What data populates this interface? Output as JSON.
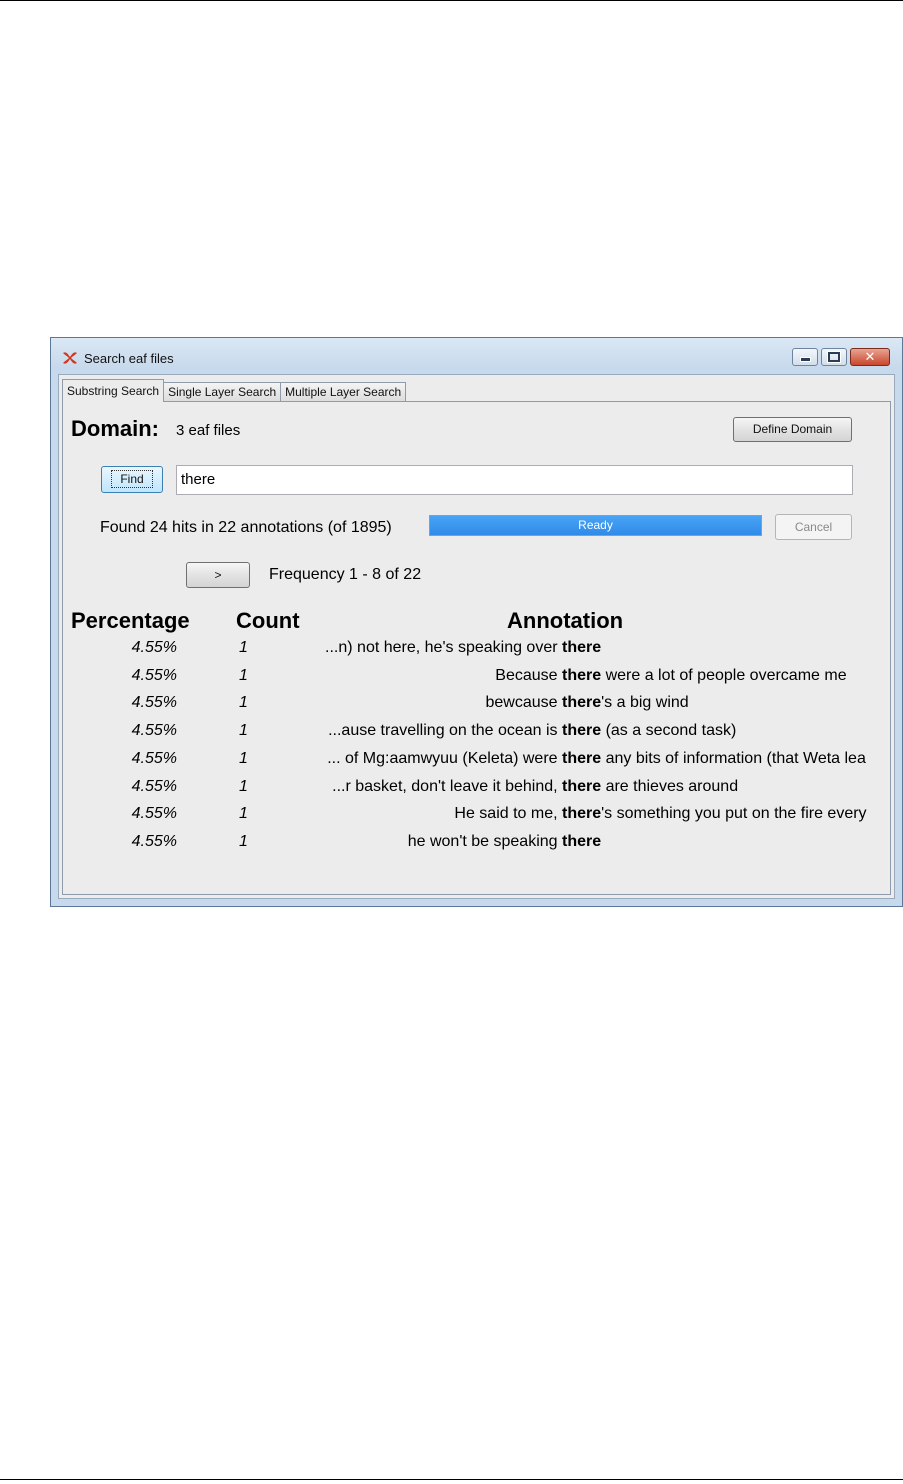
{
  "window": {
    "title": "Search eaf files",
    "buttons": {
      "minimize": "minimize",
      "maximize": "maximize",
      "close": "✕"
    }
  },
  "tabs": [
    {
      "label": "Substring Search",
      "active": true
    },
    {
      "label": "Single Layer Search",
      "active": false
    },
    {
      "label": "Multiple Layer Search",
      "active": false
    }
  ],
  "domain": {
    "label": "Domain:",
    "value": "3 eaf files",
    "define_button": "Define Domain"
  },
  "search": {
    "find_button": "Find",
    "query": "there"
  },
  "status": {
    "text": "Found 24 hits in 22 annotations (of 1895)",
    "progress_label": "Ready",
    "progress_fraction": 1.0,
    "cancel_button": "Cancel"
  },
  "pager": {
    "next_button": ">",
    "text": "Frequency 1 - 8 of 22"
  },
  "table": {
    "headers": {
      "percentage": "Percentage",
      "count": "Count",
      "annotation": "Annotation"
    },
    "rows": [
      {
        "percentage": "4.55%",
        "count": "1",
        "before": "...n) not here, he's speaking over ",
        "match": "there",
        "after": ""
      },
      {
        "percentage": "4.55%",
        "count": "1",
        "before": "Because ",
        "match": "there",
        "after": " were a lot of people overcame me"
      },
      {
        "percentage": "4.55%",
        "count": "1",
        "before": "bewcause ",
        "match": "there",
        "after": "'s a big wind"
      },
      {
        "percentage": "4.55%",
        "count": "1",
        "before": "...ause travelling on the ocean is ",
        "match": "there",
        "after": " (as a second task)"
      },
      {
        "percentage": "4.55%",
        "count": "1",
        "before": "... of Mg:aamwyuu (Keleta) were ",
        "match": "there",
        "after": " any bits of information (that Weta lea"
      },
      {
        "percentage": "4.55%",
        "count": "1",
        "before": "...r basket, don't leave it behind, ",
        "match": "there",
        "after": " are thieves around"
      },
      {
        "percentage": "4.55%",
        "count": "1",
        "before": "He said to me, ",
        "match": "there",
        "after": "'s something you put on the fire every"
      },
      {
        "percentage": "4.55%",
        "count": "1",
        "before": "he won't be speaking ",
        "match": "there",
        "after": ""
      }
    ]
  },
  "colors": {
    "progress": "#3b95ee",
    "titlebar": "#c7d9ec",
    "close_button": "#c9462c",
    "panel": "#ececec"
  },
  "icons": {
    "app": "elan-app-icon"
  }
}
